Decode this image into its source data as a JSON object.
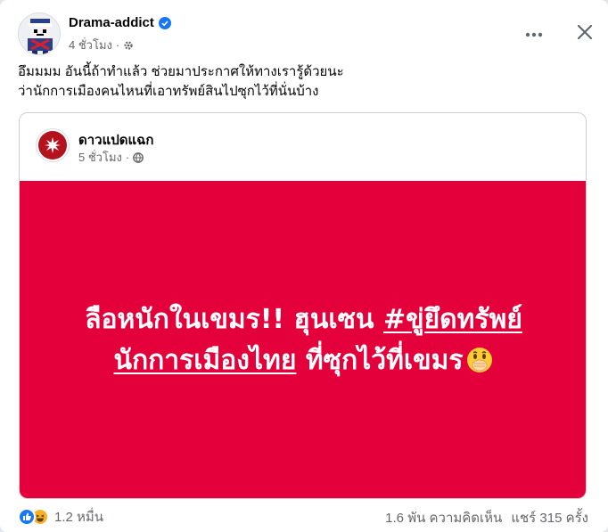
{
  "post": {
    "author": "Drama-addict",
    "time": "4 ชั่วโมง",
    "text_line1": "อึมมมม อันนี้ถ้าทำแล้ว ช่วยมาประกาศให้ทางเรารู้ด้วยนะ",
    "text_line2": "ว่านักการเมืองคนไหนที่เอาทรัพย์สินไปซุกไว้ที่นั่นบ้าง"
  },
  "shared_post": {
    "page_name": "ดาวแปดแฉก",
    "time": "5 ชั่วโมง",
    "banner_color": "#e4003b",
    "banner_line1_a": "ลือหนักในเขมร!! ฮุนเซน ",
    "banner_line1_b": "#ขู่ยึดทรัพย์",
    "banner_line2_a": "นักการเมืองไทย",
    "banner_line2_b": " ที่ซุกไว้ที่เขมร"
  },
  "footer": {
    "reaction_count": "1.2 หมื่น",
    "comments": "1.6 พัน ความคิดเห็น",
    "shares": "แชร์ 315 ครั้ง"
  },
  "icons": {
    "verified": "verified-badge-icon",
    "privacy_friends": "gear-icon",
    "privacy_public": "globe-icon",
    "more": "more-horizontal-icon",
    "close": "close-icon",
    "like": "like-icon",
    "haha": "haha-icon",
    "emoji": "face-with-hand-over-mouth-icon"
  },
  "colors": {
    "accent_blue": "#1877f2",
    "muted_text": "#65676b"
  }
}
